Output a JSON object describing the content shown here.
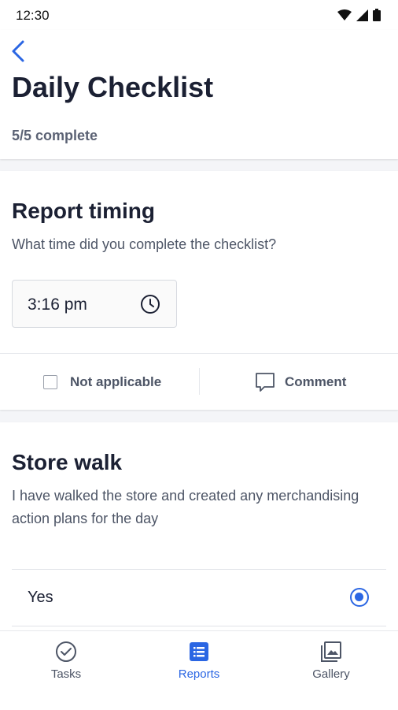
{
  "status_bar": {
    "time": "12:30",
    "icons": [
      "wifi-icon",
      "signal-icon",
      "battery-icon"
    ]
  },
  "header": {
    "back_icon": "chevron-left-icon",
    "title": "Daily Checklist",
    "progress": "5/5 complete"
  },
  "report_timing": {
    "title": "Report timing",
    "question": "What time did you complete the checklist?",
    "time_value": "3:16 pm",
    "not_applicable_label": "Not applicable",
    "not_applicable_checked": false,
    "comment_label": "Comment"
  },
  "store_walk": {
    "title": "Store walk",
    "description": "I have walked the store and created any merchandising action plans for the day",
    "options": [
      {
        "label": "Yes",
        "selected": true
      }
    ]
  },
  "bottom_nav": {
    "items": [
      {
        "label": "Tasks",
        "icon": "check-circle-icon",
        "active": false
      },
      {
        "label": "Reports",
        "icon": "list-icon",
        "active": true
      },
      {
        "label": "Gallery",
        "icon": "gallery-icon",
        "active": false
      }
    ]
  },
  "colors": {
    "accent": "#2b66e3",
    "title": "#1b2033",
    "muted": "#4d5566",
    "background": "#f4f5f8"
  }
}
